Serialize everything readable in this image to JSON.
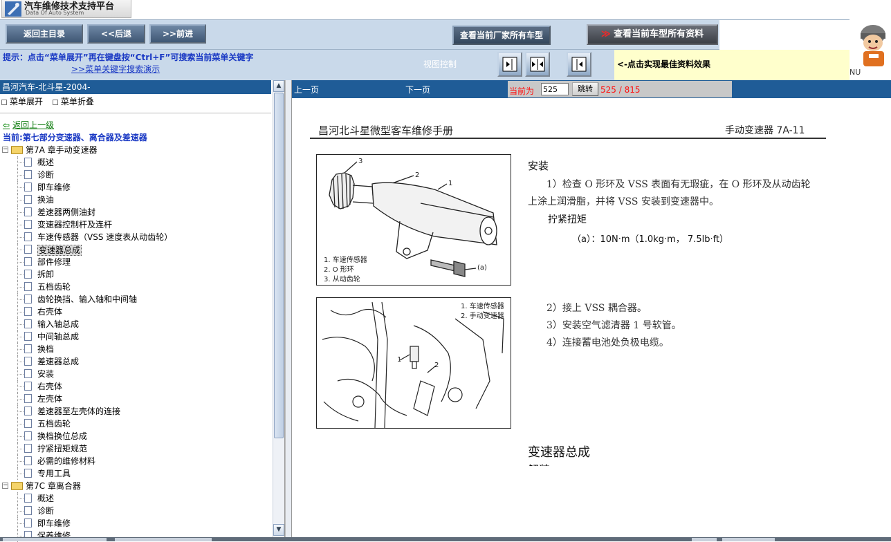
{
  "app": {
    "title": "汽车维修技术支持平台",
    "subtitle": "Data Of Auto System"
  },
  "nav": {
    "home_label": "返回主目录",
    "back_label": "<<后退",
    "forward_label": ">>前进",
    "factory_models_label": "查看当前厂家所有车型",
    "model_docs_label": "查看当前车型所有资料",
    "model_docs_prefix": "≫"
  },
  "hint": {
    "text": "提示：点击“菜单展开”再在键盘按“Ctrl+F”可搜索当前菜单关键字",
    "link": ">>菜单关键字搜索演示",
    "view_control": "视图控制",
    "tip": "<-点击实现最佳资料效果"
  },
  "mascot": {
    "label": "NU"
  },
  "left": {
    "header": "昌河汽车-北斗星-2004-",
    "expand_label": "菜单展开",
    "collapse_label": "菜单折叠",
    "back_up_label": "返回上一级",
    "current_label": "当前:第七部分变速器、离合器及差速器",
    "chapter1": "第7A 章手动变速器",
    "items": [
      "概述",
      "诊断",
      "即车维修",
      "换油",
      "差速器两侧油封",
      "变速器控制杆及连杆",
      "车速传感器（VSS 速度表从动齿轮）",
      "变速器总成",
      "部件修理",
      "拆卸",
      "五档齿轮",
      "齿轮换挡、输入轴和中间轴",
      "右壳体",
      "输入轴总成",
      "中间轴总成",
      "换档",
      "差速器总成",
      "安装",
      "右壳体",
      "左壳体",
      "差速器至左壳体的连接",
      "五档齿轮",
      "换档换位总成",
      "拧紧扭矩规范",
      "必需的维修材料",
      "专用工具"
    ],
    "selected_index": 7,
    "chapter2": "第7C 章离合器",
    "items2": [
      "概述",
      "诊断",
      "即车维修",
      "保养维修"
    ]
  },
  "pager": {
    "prev": "上一页",
    "next": "下一页",
    "current_label": "当前为",
    "current_value": "525",
    "jump_label": "跳转",
    "count": "525 / 815"
  },
  "doc": {
    "header_left": "昌河北斗星微型客车维修手册",
    "header_right": "手动变速器 7A-11",
    "fig1": {
      "callouts": [
        "3",
        "2",
        "1",
        "(a)"
      ],
      "legend": [
        "1. 车速传感器",
        "2. O 形环",
        "3. 从动齿轮"
      ]
    },
    "fig2": {
      "callouts": [
        "1",
        "2"
      ],
      "legend": [
        "1. 车速传感器",
        "2. 手动变速器"
      ]
    },
    "section_title": "安装",
    "step1_line1": "1）检查 O 形环及 VSS 表面有无瑕疵，在 O 形环及从动齿轮",
    "step1_line2": "上涂上润滑脂，并将 VSS 安装到变速器中。",
    "torque_title": "拧紧扭矩",
    "torque_value": "（a）：10N·m（1.0kg·m， 7.5lb·ft）",
    "step2": "2）接上 VSS 耦合器。",
    "step3": "3）安装空气滤清器 1 号软管。",
    "step4": "4）连接蓄电池处负极电缆。",
    "next_section_title": "变速器总成",
    "next_section_sub": "解装"
  }
}
